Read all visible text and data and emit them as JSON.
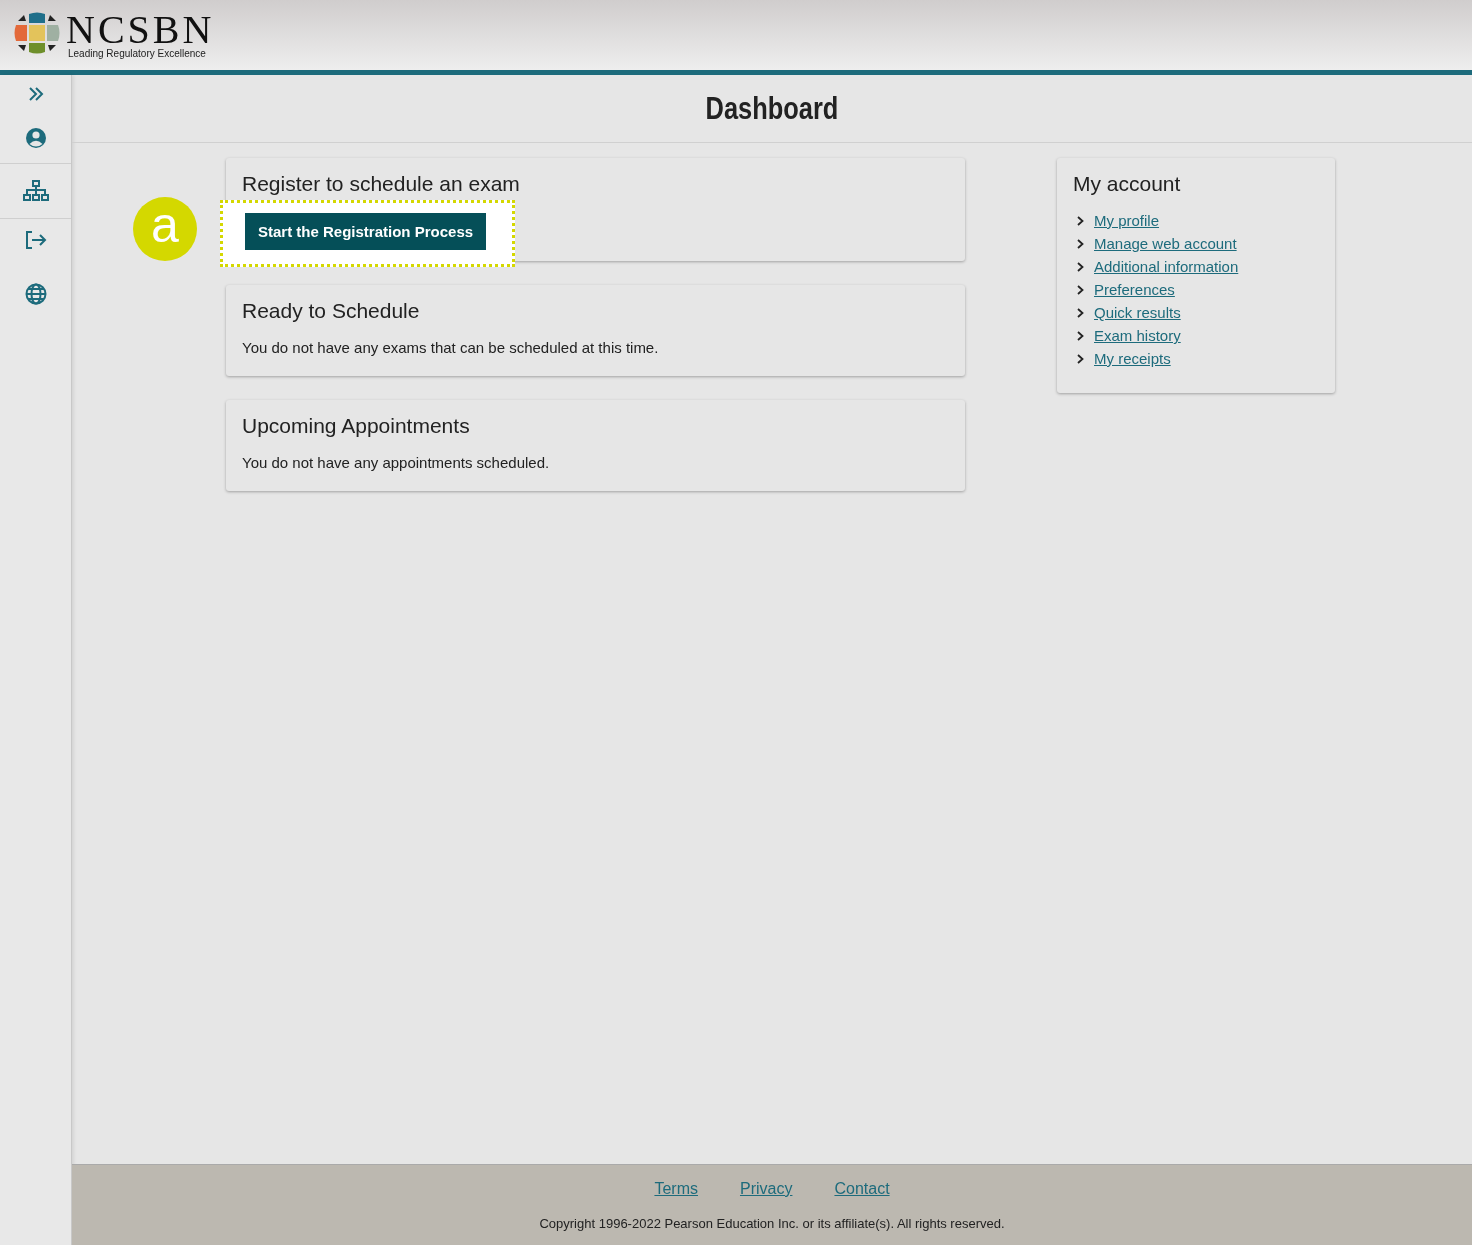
{
  "header": {
    "logo_name": "NCSBN",
    "logo_tagline": "Leading Regulatory Excellence"
  },
  "page_title": "Dashboard",
  "register_card": {
    "title": "Register to schedule an exam",
    "button": "Start the Registration Process",
    "highlighted": true,
    "callout": "a"
  },
  "info_cards": [
    {
      "title": "Ready to Schedule",
      "text": "You do not have any exams that can be scheduled at this time."
    },
    {
      "title": "Upcoming Appointments",
      "text": "You do not have any appointments scheduled."
    }
  ],
  "account": {
    "title": "My account",
    "links": [
      "My profile",
      "Manage web account",
      "Additional information",
      "Preferences",
      "Quick results",
      "Exam history",
      "My receipts"
    ]
  },
  "footer": {
    "links": [
      "Terms",
      "Privacy",
      "Contact"
    ],
    "copyright": "Copyright 1996-2022 Pearson Education Inc. or its affiliate(s). All rights reserved."
  }
}
